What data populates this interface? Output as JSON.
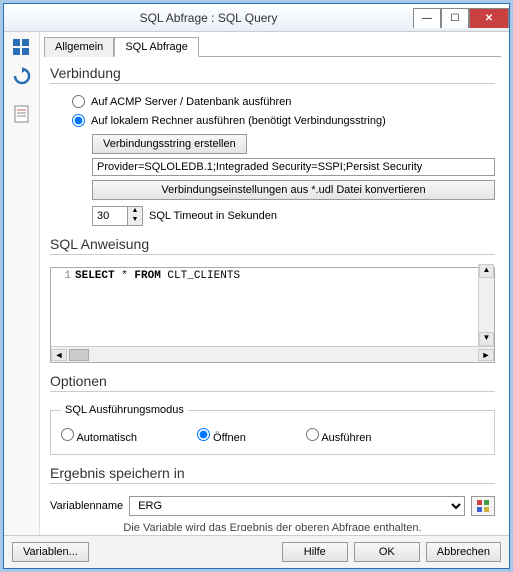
{
  "window": {
    "title": "SQL Abfrage : SQL Query"
  },
  "tabs": {
    "general": "Allgemein",
    "sql": "SQL Abfrage"
  },
  "sections": {
    "connection": "Verbindung",
    "statement": "SQL Anweisung",
    "options": "Optionen",
    "result": "Ergebnis speichern in"
  },
  "connection": {
    "radio_server": "Auf ACMP Server / Datenbank ausführen",
    "radio_local": "Auf lokalem Rechner ausführen (benötigt Verbindungsstring)",
    "create_conn_btn": "Verbindungsstring erstellen",
    "conn_string": "Provider=SQLOLEDB.1;Integraded Security=SSPI;Persist Security",
    "convert_btn": "Verbindungseinstellungen aus *.udl Datei konvertieren",
    "timeout_value": "30",
    "timeout_label": "SQL Timeout in Sekunden"
  },
  "chart_data": null,
  "sql": {
    "line_no": "1",
    "kw_select": "SELECT",
    "star": " * ",
    "kw_from": "FROM",
    "table": " CLT_CLIENTS"
  },
  "options": {
    "group_label": "SQL Ausführungsmodus",
    "auto": "Automatisch",
    "open": "Öffnen",
    "exec": "Ausführen"
  },
  "result": {
    "var_label": "Variablenname",
    "var_value": "ERG",
    "note": "Die Variable wird das Ergebnis der oberen Abfrage enthalten."
  },
  "footer": {
    "variables": "Variablen...",
    "help": "Hilfe",
    "ok": "OK",
    "cancel": "Abbrechen"
  }
}
